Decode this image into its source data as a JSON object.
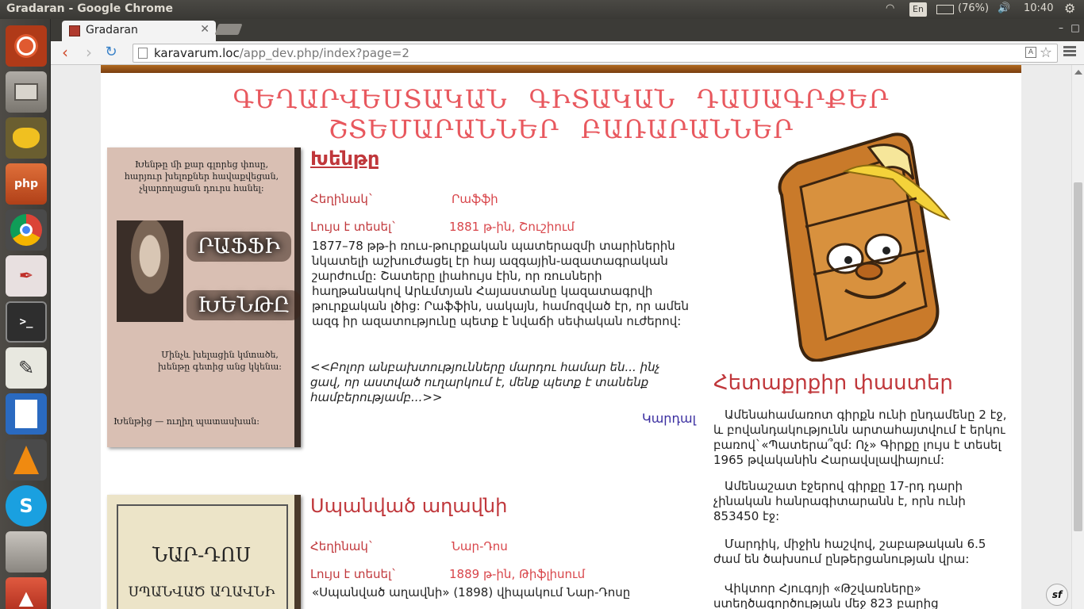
{
  "system": {
    "window_title": "Gradaran - Google Chrome",
    "keyboard_layout": "En",
    "battery": "(76%)",
    "time": "10:40"
  },
  "launcher": {
    "items": [
      {
        "name": "ubuntu-dash",
        "label": "",
        "color": "#d84e2a"
      },
      {
        "name": "files",
        "label": "",
        "color": "#8a8580"
      },
      {
        "name": "teapot-app",
        "label": "",
        "color": "#f0c020"
      },
      {
        "name": "php-app",
        "label": "php",
        "color": "#d05a28"
      },
      {
        "name": "chrome",
        "label": "",
        "color": "#4a90d9"
      },
      {
        "name": "document-viewer",
        "label": "",
        "color": "#e8e0e0"
      },
      {
        "name": "terminal",
        "label": ">_",
        "color": "#2e2e2e"
      },
      {
        "name": "text-editor",
        "label": "",
        "color": "#e8e8e0"
      },
      {
        "name": "writer",
        "label": "",
        "color": "#2a6ac0"
      },
      {
        "name": "vlc",
        "label": "",
        "color": "#f08a10"
      },
      {
        "name": "skype",
        "label": "S",
        "color": "#1aa0e0"
      },
      {
        "name": "workspaces",
        "label": "",
        "color": "#9a9690"
      },
      {
        "name": "software-updater",
        "label": "",
        "color": "#c83a28"
      }
    ]
  },
  "browser": {
    "tab_title": "Gradaran",
    "url_host": "karavarum.loc",
    "url_path": "/app_dev.php/index?page=2"
  },
  "page": {
    "nav": [
      "Գեղարվեստական",
      "Գիտական",
      "Դասագրքեր",
      "Շտեմարաններ",
      "Բառարաններ"
    ],
    "books": [
      {
        "title": "Խենթը",
        "author_label": "Հեղինակ`",
        "author": "Րաֆֆի",
        "published_label": "Լույս է տեսել`",
        "published": "1881 թ-ին, Շուշիում",
        "description": "1877–78 թթ-ի ռուս-թուրքական պատերազմի տարիներին նկատելի աշխուժացել էր հայ ազգային-ազատագրական շարժումը: Շատերը լիահույս էին, որ ռուսների հաղթանակով Արևմտյան Հայաստանը կազատագրվի թուրքական լծից: Րաֆֆին, սակայն, համոզված էր, որ ամեն ազգ իր ազատությունը պետք է նվաճի սեփական ուժերով:",
        "quote": "<<Բոլոր անբախտությունները մարդու համար են... ինչ ցավ, որ աստված ուղարկում է, մենք պետք է տանենք համբերությամբ...>>",
        "read_label": "Կարդալ",
        "cover": {
          "top_text": "Խենթը մի քար գլորեց փոսը, հարյուր խելոքներ հավաքվեցան, չկարողացան դուրս հանել:",
          "author": "ՐԱՖՖԻ",
          "title": "ԽԵՆԹԸ",
          "bottom_text": "Մինչև խելացին կմտածե, խենթը գետից անց կկենա:",
          "footer": "Խենթից — ուղիղ պատասխան:"
        }
      },
      {
        "title": "Սպանված աղավնի",
        "author_label": "Հեղինակ`",
        "author": "Նար-Դոս",
        "published_label": "Լույս է տեսել`",
        "published": "1889 թ-ին, Թիֆլիսում",
        "description": "«Սպանված աղավնի» (1898) վիպակում Նար-Դոսը",
        "cover": {
          "author": "ՆԱՐ-ԴՈՍ",
          "title": "ՍՊԱՆՎԱԾ ԱՂԱՎՆԻ"
        }
      }
    ],
    "facts": {
      "title": "Հետաքրքիր փաստեր",
      "items": [
        "Ամենահամառոտ գիրքն ունի ընդամենը 2 էջ, և բովանդակությունն արտահայտվում է երկու բառով`«Պատերա՞զմ: Ոչ» Գիրքը լույս է տեսել 1965 թվականին Հարավսլավիայում:",
        "Ամենաշատ էջերով գիրքը 17-րդ դարի չինական հանրագիտարանն է, որն ունի 853450 էջ:",
        "Մարդիկ, միջին հաշվով, շաբաթական 6.5 ժամ են ծախսում ընթերցանության վրա:",
        "Վիկտոր Հյուգոյի «Թշվառները» ստեղծագործության մեջ 823 բարից"
      ]
    }
  }
}
